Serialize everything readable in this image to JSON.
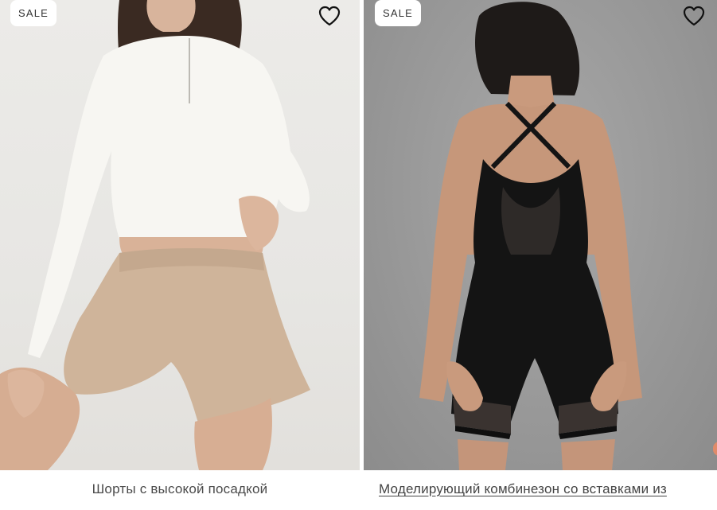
{
  "products": [
    {
      "badge": "SALE",
      "title": "Шорты с высокой посадкой",
      "favorite_icon": "heart-outline-icon",
      "image_subject": "woman in white ribbed zip-up crop top and beige high-waist shorts"
    },
    {
      "badge": "SALE",
      "title": "Моделирующий комбинезон со вставками из",
      "favorite_icon": "heart-outline-icon",
      "image_subject": "woman in black cross-back unitard with mesh inserts, back view"
    }
  ],
  "colors": {
    "badge_bg": "#ffffff",
    "badge_text": "#333333",
    "title_text": "#4a4a4a",
    "left_photo_bg": "#e8e7e4",
    "right_photo_bg": "#9a9a9a"
  }
}
